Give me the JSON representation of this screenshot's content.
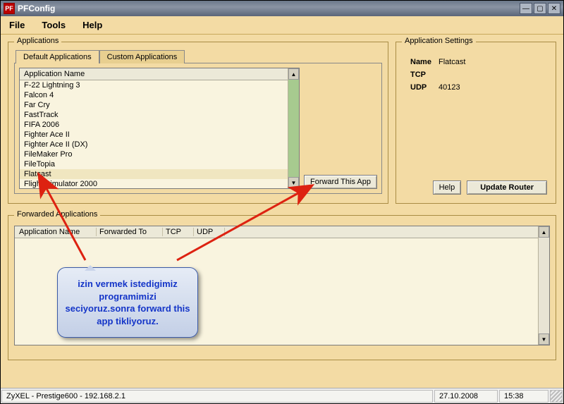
{
  "window": {
    "title": "PFConfig",
    "icon_text": "PF"
  },
  "menu": {
    "file": "File",
    "tools": "Tools",
    "help": "Help"
  },
  "applications": {
    "group_title": "Applications",
    "tabs": {
      "default": "Default Applications",
      "custom": "Custom Applications"
    },
    "list_header": "Application Name",
    "items": [
      "F-22 Lightning 3",
      "Falcon 4",
      "Far Cry",
      "FastTrack",
      "FIFA 2006",
      "Fighter Ace II",
      "Fighter Ace II (DX)",
      "FileMaker Pro",
      "FileTopia",
      "Flatcast",
      "Flight Simulator 2000"
    ],
    "selected_index": 9,
    "forward_button": "Forward This App"
  },
  "settings": {
    "group_title": "Application Settings",
    "name_label": "Name",
    "name_value": "Flatcast",
    "tcp_label": "TCP",
    "tcp_value": "",
    "udp_label": "UDP",
    "udp_value": "40123",
    "help_button": "Help",
    "update_button": "Update Router"
  },
  "forwarded": {
    "group_title": "Forwarded Applications",
    "columns": [
      "Application Name",
      "Forwarded To",
      "TCP",
      "UDP"
    ]
  },
  "statusbar": {
    "router": "ZyXEL - Prestige600  - 192.168.2.1",
    "date": "27.10.2008",
    "time": "15:38"
  },
  "callout": {
    "text": "izin vermek istedigimiz programimizi seciyoruz.sonra forward this app tikliyoruz."
  }
}
